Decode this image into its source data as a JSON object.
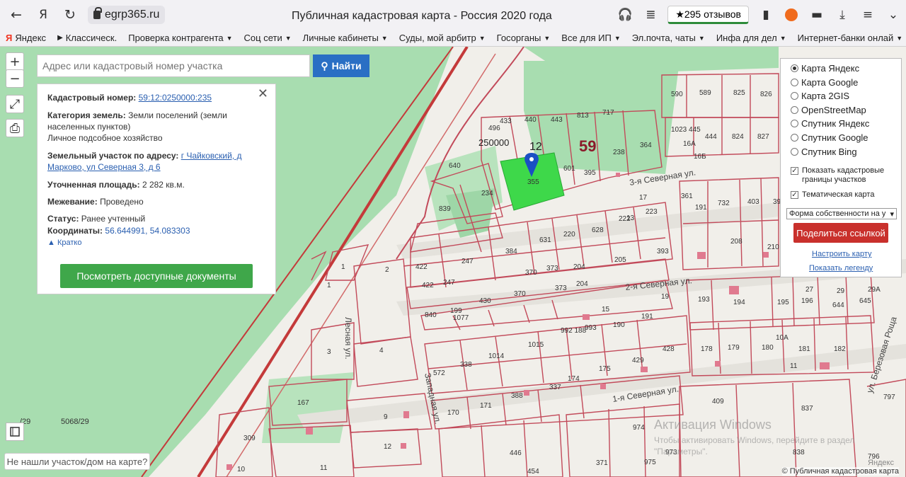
{
  "browser": {
    "url": "egrp365.ru",
    "title": "Публичная кадастровая карта - Россия 2020 года",
    "reviews": "★295 отзывов",
    "bookmarks": [
      {
        "label": "Яндекс",
        "dropdown": false,
        "icon": "yandex-icon"
      },
      {
        "label": "Классическ.",
        "dropdown": false,
        "icon": "play-icon"
      },
      {
        "label": "Проверка контрагента",
        "dropdown": true
      },
      {
        "label": "Соц сети",
        "dropdown": true
      },
      {
        "label": "Личные кабинеты",
        "dropdown": true
      },
      {
        "label": "Суды, мой арбитр",
        "dropdown": true
      },
      {
        "label": "Госорганы",
        "dropdown": true
      },
      {
        "label": "Все для ИП",
        "dropdown": true
      },
      {
        "label": "Эл.почта, чаты",
        "dropdown": true
      },
      {
        "label": "Инфа для дел",
        "dropdown": true
      },
      {
        "label": "Интернет-банки онлай",
        "dropdown": true
      }
    ]
  },
  "search": {
    "placeholder": "Адрес или кадастровый номер участка",
    "button": "Найти"
  },
  "info_panel": {
    "cadastral_label": "Кадастровый номер:",
    "cadastral_value": "59:12:0250000:235",
    "category_label": "Категория земель:",
    "category_value": "Земли поселений (земли населенных пунктов)",
    "use_value": "Личное подсобное хозяйство",
    "address_label": "Земельный участок по адресу:",
    "address_value": "г Чайковский, д Марково, ул Северная 3, д 6",
    "area_label": "Уточненная площадь:",
    "area_value": "2 282 кв.м.",
    "survey_label": "Межевание:",
    "survey_value": "Проведено",
    "status_label": "Статус:",
    "status_value": "Ранее учтенный",
    "coords_label": "Координаты:",
    "coords_value": "56.644991, 54.083303",
    "collapse": "▲ Кратко",
    "docs_button": "Посмотреть доступные документы"
  },
  "layers": {
    "maps": [
      {
        "label": "Карта Яндекс",
        "selected": true
      },
      {
        "label": "Карта Google",
        "selected": false
      },
      {
        "label": "Карта 2GIS",
        "selected": false
      },
      {
        "label": "OpenStreetMap",
        "selected": false
      },
      {
        "label": "Спутник Яндекс",
        "selected": false
      },
      {
        "label": "Спутник Google",
        "selected": false
      },
      {
        "label": "Спутник Bing",
        "selected": false
      }
    ],
    "show_borders": "Показать кадастровые границы участков",
    "thematic": "Тематическая карта",
    "select_value": "Форма собственности на у",
    "share_button": "Поделиться ссылкой",
    "configure_link": "Настроить карту",
    "legend_link": "Показать легенду"
  },
  "map": {
    "streets": {
      "s3": "3-я Северная ул.",
      "s2": "2-я Северная ул.",
      "s1": "1-я Северная ул.",
      "lesnaya": "Лесная ул.",
      "zapadnaya": "Западная ул.",
      "berezovaya": "ул. Березовая Роща"
    },
    "big_number": "59",
    "mid_number": "12",
    "zone_number": "250000",
    "bottom_left": "5068/29",
    "bottom_left2": "/29",
    "yandex_mark": "Яндекс"
  },
  "not_found": "Не нашли участок/дом на карте?",
  "watermark": {
    "title": "Активация Windows",
    "sub": "Чтобы активировать Windows, перейдите в раздел \"Параметры\"."
  },
  "copyright": "© Публичная кадастровая карта",
  "colors": {
    "selected_plot": "#3ed84a",
    "plot_border": "#c24a5a",
    "forest": "#a8ddb0",
    "rail": "#c43a3a",
    "search_button": "#2a6fc4",
    "docs_button": "#3fa74a",
    "share_button": "#c9302c"
  }
}
